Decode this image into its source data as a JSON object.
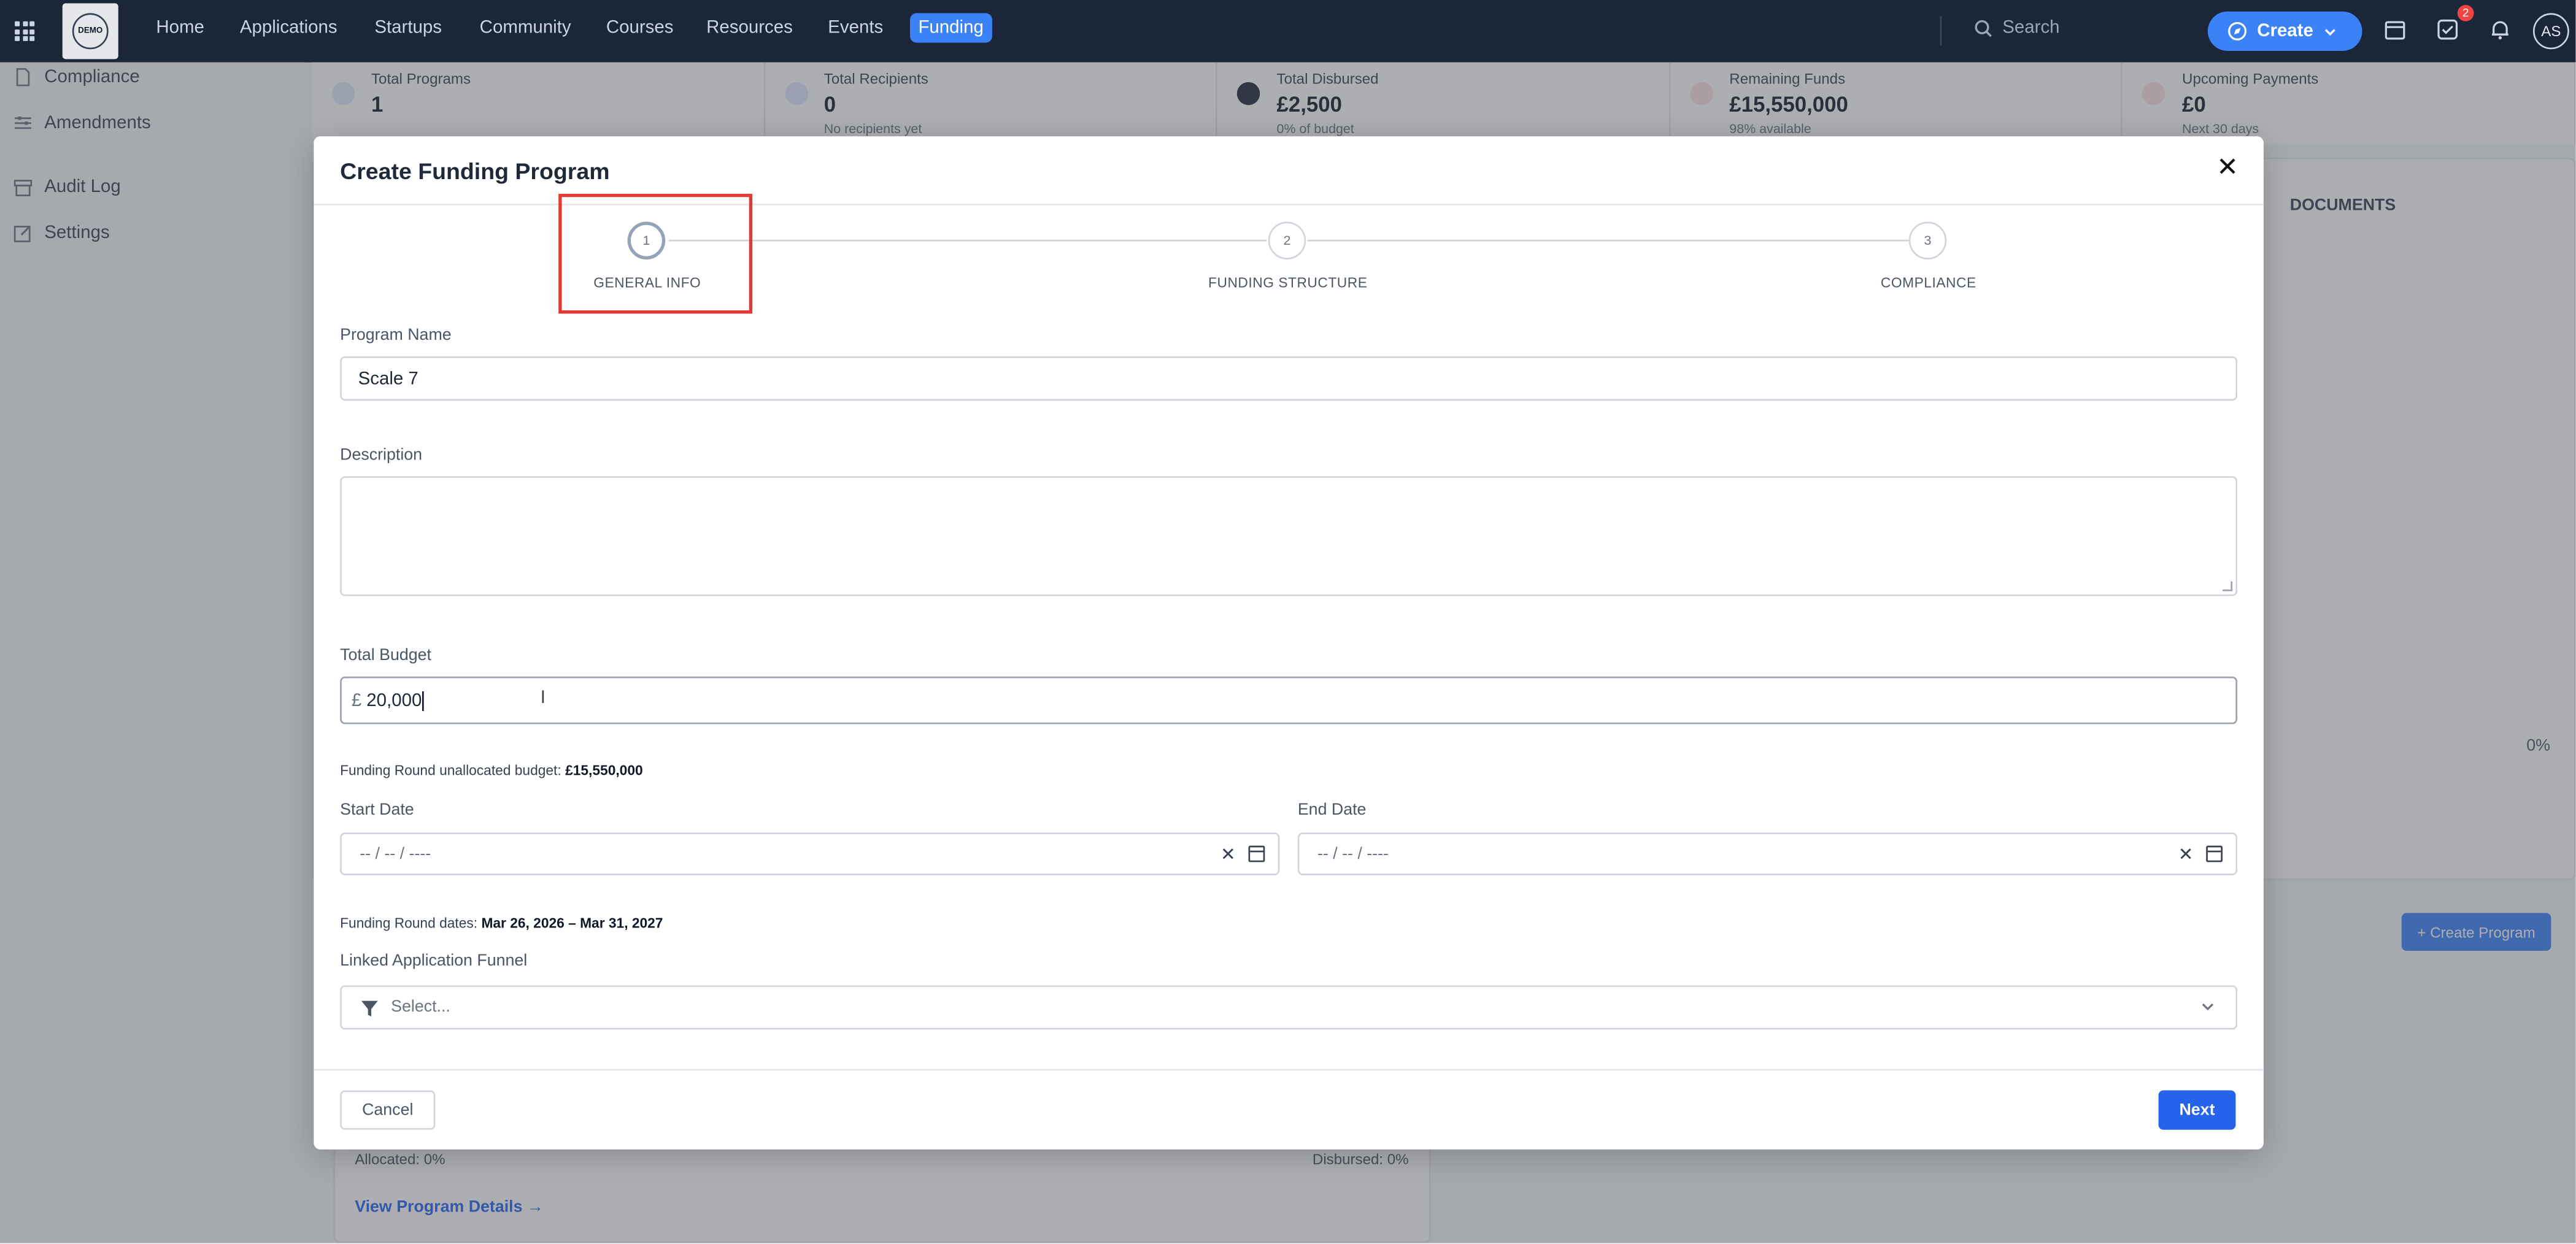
{
  "nav": {
    "items": [
      "Home",
      "Applications",
      "Startups",
      "Community",
      "Courses",
      "Resources",
      "Events",
      "Funding"
    ],
    "active": "Funding",
    "logo_text": "DEMO",
    "search_placeholder": "Search",
    "create_label": "Create",
    "notification_count": "2",
    "avatar_initials": "AS"
  },
  "sidebar": {
    "items": [
      "Compliance",
      "Amendments",
      "Audit Log",
      "Settings"
    ]
  },
  "stats": [
    {
      "label": "Total Programs",
      "value": "1",
      "sub": ""
    },
    {
      "label": "Total Recipients",
      "value": "0",
      "sub": "No recipients yet"
    },
    {
      "label": "Total Disbursed",
      "value": "£2,500",
      "sub": "0% of budget"
    },
    {
      "label": "Remaining Funds",
      "value": "£15,550,000",
      "sub": "98% available"
    },
    {
      "label": "Upcoming Payments",
      "value": "£0",
      "sub": "Next 30 days"
    }
  ],
  "background": {
    "documents_tab": "DOCUMENTS",
    "percent": "0%",
    "create_program": "+ Create Program",
    "allocated": "Allocated: 0%",
    "disbursed": "Disbursed: 0%",
    "view_details": "View Program Details →"
  },
  "modal": {
    "title": "Create Funding Program",
    "steps": [
      {
        "num": "1",
        "label": "GENERAL INFO"
      },
      {
        "num": "2",
        "label": "FUNDING STRUCTURE"
      },
      {
        "num": "3",
        "label": "COMPLIANCE"
      }
    ],
    "program_name_label": "Program Name",
    "program_name_value": "Scale 7",
    "description_label": "Description",
    "total_budget_label": "Total Budget",
    "currency": "£",
    "total_budget_value": "20,000",
    "unallocated_hint": "Funding Round unallocated budget:",
    "unallocated_value": "£15,550,000",
    "start_date_label": "Start Date",
    "end_date_label": "End Date",
    "date_placeholder": "-- / -- / ----",
    "round_dates_hint": "Funding Round dates:",
    "round_dates_value": "Mar 26, 2026 – Mar 31, 2027",
    "funnel_label": "Linked Application Funnel",
    "funnel_placeholder": "Select...",
    "cancel_label": "Cancel",
    "next_label": "Next"
  },
  "colors": {
    "nav_bg": "#1b2638",
    "accent": "#3b82f6",
    "primary_button": "#2563eb",
    "highlight_box": "#e53935"
  }
}
